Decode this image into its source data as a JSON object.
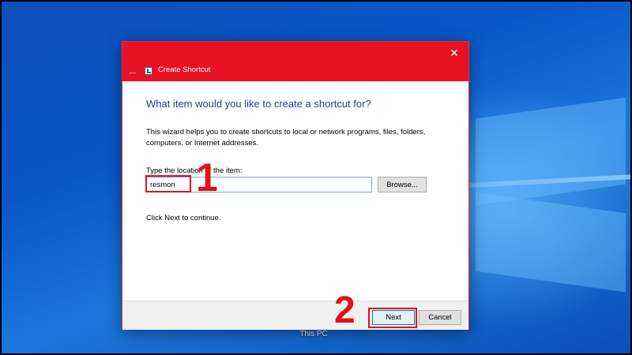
{
  "desktop": {
    "this_pc_label": "This PC"
  },
  "dialog": {
    "title": "Create Shortcut",
    "back_glyph": "←",
    "close_glyph": "✕",
    "heading": "What item would you like to create a shortcut for?",
    "description": "This wizard helps you to create shortcuts to local or network programs, files, folders, computers, or Internet addresses.",
    "location_label": "Type the location of the item:",
    "location_value": "resmon",
    "browse_label": "Browse...",
    "continue_text": "Click Next to continue.",
    "next_label": "Next",
    "cancel_label": "Cancel"
  },
  "annotations": {
    "step1": "1",
    "step2": "2"
  },
  "colors": {
    "titlebar": "#e81123",
    "heading": "#1f3d99",
    "annotation": "#e3101b"
  }
}
